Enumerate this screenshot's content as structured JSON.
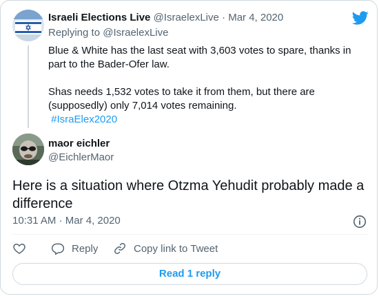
{
  "colors": {
    "accent": "#1d9bf0",
    "muted": "#536471",
    "text": "#0f1419",
    "border": "#cfd9de"
  },
  "quoted": {
    "author_name": "Israeli Elections Live",
    "author_handle": "@IsraelexLive",
    "date": "· Mar 4, 2020",
    "replying_label": "Replying to",
    "replying_handle": "@IsraelexLive",
    "paragraph1": "Blue & White has the last seat with 3,603 votes to spare, thanks in part to the Bader-Ofer law.",
    "paragraph2": "Shas needs 1,532 votes to take it from them, but there are (supposedly) only 7,014 votes remaining.",
    "hashtag": "#IsraElex2020",
    "avatar_icon": "israel-flag-icon"
  },
  "tweet": {
    "author_name": "maor eichler",
    "author_handle": "@EichlerMaor",
    "text": "Here is a situation where Otzma Yehudit probably made a difference",
    "time": "10:31 AM",
    "date": "· Mar 4, 2020"
  },
  "actions": {
    "like_icon": "heart-icon",
    "reply_label": "Reply",
    "copy_label": "Copy link to Tweet"
  },
  "read_reply_label": "Read 1 reply",
  "brand_icon": "twitter-bird-icon",
  "info_icon": "info-icon"
}
